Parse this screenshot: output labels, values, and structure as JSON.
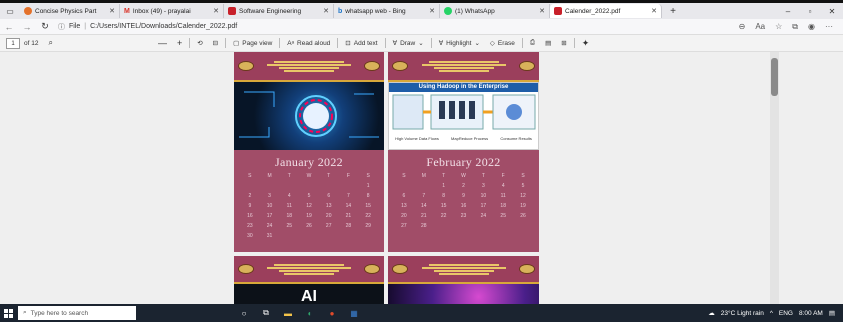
{
  "tabs": [
    {
      "label": "Concise Physics Part",
      "icon": "orange-circle-icon",
      "color": "#e4712a",
      "active": false
    },
    {
      "label": "Inbox (49) - prayalai",
      "icon": "gmail-icon",
      "color": "#d93025",
      "active": false
    },
    {
      "label": "Software Engineering",
      "icon": "pdf-icon",
      "color": "#c8202a",
      "active": false
    },
    {
      "label": "whatsapp web - Bing",
      "icon": "bing-icon",
      "color": "#1a73c8",
      "active": false
    },
    {
      "label": "(1) WhatsApp",
      "icon": "whatsapp-icon",
      "color": "#25d366",
      "active": false
    },
    {
      "label": "Calender_2022.pdf",
      "icon": "pdf-icon",
      "color": "#c8202a",
      "active": true
    }
  ],
  "browser": {
    "new_tab": "+",
    "minimize": "–",
    "maximize": "▫",
    "close": "✕",
    "address_label": "File",
    "address_url": "C:/Users/INTEL/Downloads/Calender_2022.pdf",
    "more": "···"
  },
  "pdf_toolbar": {
    "page_number": "1",
    "page_count": "of 12",
    "page_view": "Page view",
    "read_aloud": "Read aloud",
    "add_text": "Add text",
    "draw": "Draw",
    "highlight": "Highlight",
    "erase": "Erase"
  },
  "pages": [
    {
      "month": "January 2022",
      "weekdays": [
        "S",
        "M",
        "T",
        "W",
        "T",
        "F",
        "S"
      ],
      "days": [
        "",
        "",
        "",
        "",
        "",
        "",
        "1",
        "2",
        "3",
        "4",
        "5",
        "6",
        "7",
        "8",
        "9",
        "10",
        "11",
        "12",
        "13",
        "14",
        "15",
        "16",
        "17",
        "18",
        "19",
        "20",
        "21",
        "22",
        "23",
        "24",
        "25",
        "26",
        "27",
        "28",
        "29",
        "30",
        "31",
        "",
        "",
        "",
        "",
        ""
      ]
    },
    {
      "month": "February 2022",
      "weekdays": [
        "S",
        "M",
        "T",
        "W",
        "T",
        "F",
        "S"
      ],
      "days": [
        "",
        "",
        "1",
        "2",
        "3",
        "4",
        "5",
        "6",
        "7",
        "8",
        "9",
        "10",
        "11",
        "12",
        "13",
        "14",
        "15",
        "16",
        "17",
        "18",
        "19",
        "20",
        "21",
        "22",
        "23",
        "24",
        "25",
        "26",
        "27",
        "28",
        "",
        "",
        "",
        "",
        ""
      ],
      "image_title": "Using Hadoop in the Enterprise",
      "image_legend": [
        "High Volume Data Flows",
        "MapReduce Process",
        "Consume Results"
      ]
    }
  ],
  "lower_page_image_text": "AI",
  "taskbar": {
    "search_placeholder": "Type here to search",
    "weather": "23°C Light rain",
    "language": "ENG",
    "time": "8:00 AM"
  }
}
